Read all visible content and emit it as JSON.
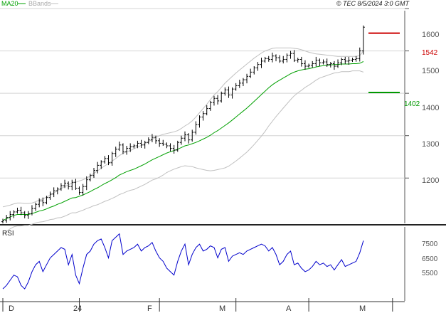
{
  "copyright": "© TEC 8/5/2024 3:0 GMT",
  "legend": {
    "ma_label": "MA20",
    "bbands_label": "BBands"
  },
  "colors": {
    "candle": "#000000",
    "ma": "#00a000",
    "bbands": "#c0c0c0",
    "rsi": "#0000cc",
    "resistance": "#cc0000",
    "support": "#009900",
    "grid": "#d4d4d4"
  },
  "chart_data": [
    {
      "type": "line",
      "title": "",
      "y_ticks": [
        "1200",
        "1300",
        "1400",
        "1500",
        "1600"
      ],
      "ylim": [
        1093,
        1595
      ],
      "month_labels": [
        {
          "label": "D",
          "index": 0
        },
        {
          "label": "24",
          "index": 21
        },
        {
          "label": "F",
          "index": 43
        },
        {
          "label": "M",
          "index": 64
        },
        {
          "label": "A",
          "index": 84
        },
        {
          "label": "M",
          "index": 107
        }
      ],
      "levels": [
        {
          "name": "resistance",
          "label": "1542",
          "value": 1542
        },
        {
          "name": "support",
          "label": "1402",
          "value": 1402
        }
      ],
      "series": [
        {
          "name": "close",
          "values": [
            1100,
            1107,
            1114,
            1120,
            1124,
            1118,
            1112,
            1116,
            1128,
            1138,
            1146,
            1142,
            1154,
            1162,
            1170,
            1174,
            1182,
            1188,
            1180,
            1190,
            1176,
            1166,
            1180,
            1196,
            1206,
            1218,
            1230,
            1238,
            1246,
            1236,
            1258,
            1268,
            1278,
            1262,
            1270,
            1274,
            1276,
            1282,
            1278,
            1284,
            1290,
            1296,
            1288,
            1282,
            1280,
            1276,
            1270,
            1266,
            1284,
            1294,
            1302,
            1290,
            1308,
            1326,
            1344,
            1352,
            1364,
            1378,
            1388,
            1382,
            1400,
            1408,
            1396,
            1410,
            1418,
            1424,
            1432,
            1440,
            1450,
            1460,
            1468,
            1476,
            1482,
            1480,
            1488,
            1484,
            1476,
            1480,
            1490,
            1494,
            1478,
            1480,
            1470,
            1464,
            1466,
            1470,
            1478,
            1472,
            1474,
            1468,
            1470,
            1464,
            1472,
            1480,
            1476,
            1478,
            1480,
            1482,
            1500,
            1556
          ]
        },
        {
          "name": "MA20",
          "values": [
            1100,
            1104,
            1108,
            1112,
            1114,
            1114,
            1114,
            1114,
            1116,
            1119,
            1122,
            1124,
            1127,
            1131,
            1134,
            1138,
            1141,
            1145,
            1149,
            1153,
            1154,
            1157,
            1160,
            1164,
            1168,
            1173,
            1177,
            1182,
            1187,
            1191,
            1196,
            1201,
            1207,
            1211,
            1215,
            1218,
            1221,
            1225,
            1229,
            1233,
            1238,
            1243,
            1247,
            1251,
            1255,
            1259,
            1262,
            1265,
            1268,
            1272,
            1276,
            1278,
            1281,
            1284,
            1288,
            1292,
            1296,
            1301,
            1307,
            1312,
            1318,
            1324,
            1330,
            1337,
            1344,
            1351,
            1358,
            1365,
            1373,
            1381,
            1389,
            1397,
            1405,
            1413,
            1420,
            1426,
            1431,
            1436,
            1441,
            1446,
            1450,
            1453,
            1455,
            1457,
            1458,
            1460,
            1462,
            1464,
            1465,
            1466,
            1467,
            1468,
            1468,
            1469,
            1469,
            1469,
            1470,
            1470,
            1471,
            1475
          ]
        },
        {
          "name": "BBands upper",
          "values": [
            1132,
            1134,
            1136,
            1139,
            1141,
            1141,
            1140,
            1140,
            1141,
            1144,
            1148,
            1151,
            1155,
            1160,
            1165,
            1170,
            1175,
            1180,
            1184,
            1188,
            1190,
            1193,
            1196,
            1200,
            1205,
            1211,
            1217,
            1223,
            1229,
            1234,
            1240,
            1246,
            1253,
            1258,
            1262,
            1265,
            1269,
            1273,
            1277,
            1281,
            1286,
            1291,
            1296,
            1300,
            1303,
            1305,
            1307,
            1309,
            1312,
            1317,
            1323,
            1328,
            1335,
            1344,
            1354,
            1364,
            1374,
            1385,
            1396,
            1404,
            1414,
            1424,
            1432,
            1440,
            1448,
            1455,
            1462,
            1469,
            1476,
            1483,
            1489,
            1495,
            1500,
            1503,
            1506,
            1507,
            1507,
            1507,
            1507,
            1507,
            1506,
            1505,
            1503,
            1500,
            1497,
            1495,
            1493,
            1492,
            1491,
            1490,
            1489,
            1488,
            1487,
            1487,
            1487,
            1487,
            1487,
            1487,
            1489,
            1500
          ]
        },
        {
          "name": "BBands lower",
          "values": [
            1068,
            1074,
            1080,
            1085,
            1087,
            1087,
            1088,
            1088,
            1091,
            1094,
            1096,
            1097,
            1099,
            1102,
            1103,
            1106,
            1107,
            1110,
            1114,
            1118,
            1118,
            1121,
            1124,
            1128,
            1131,
            1135,
            1137,
            1141,
            1145,
            1148,
            1152,
            1156,
            1161,
            1164,
            1168,
            1171,
            1173,
            1177,
            1181,
            1185,
            1190,
            1195,
            1198,
            1202,
            1207,
            1213,
            1217,
            1221,
            1224,
            1227,
            1229,
            1228,
            1227,
            1224,
            1222,
            1220,
            1218,
            1217,
            1218,
            1220,
            1222,
            1224,
            1228,
            1234,
            1240,
            1247,
            1254,
            1261,
            1270,
            1279,
            1289,
            1299,
            1310,
            1323,
            1334,
            1345,
            1355,
            1365,
            1375,
            1385,
            1394,
            1401,
            1407,
            1414,
            1419,
            1425,
            1431,
            1436,
            1439,
            1442,
            1445,
            1448,
            1449,
            1451,
            1451,
            1451,
            1453,
            1453,
            1453,
            1450
          ]
        },
        {
          "name": "RSI",
          "values": [
            50,
            52,
            55,
            58,
            57,
            52,
            50,
            54,
            60,
            64,
            66,
            60,
            64,
            68,
            70,
            72,
            74,
            73,
            64,
            70,
            58,
            53,
            62,
            70,
            72,
            76,
            78,
            79,
            74,
            68,
            78,
            80,
            82,
            70,
            72,
            73,
            74,
            76,
            72,
            74,
            75,
            77,
            72,
            68,
            66,
            62,
            60,
            58,
            66,
            72,
            76,
            64,
            70,
            74,
            76,
            72,
            73,
            75,
            74,
            68,
            73,
            74,
            66,
            69,
            70,
            71,
            70,
            72,
            73,
            74,
            75,
            76,
            75,
            72,
            74,
            70,
            64,
            66,
            70,
            72,
            64,
            65,
            62,
            60,
            61,
            63,
            66,
            64,
            65,
            63,
            64,
            61,
            64,
            67,
            63,
            64,
            65,
            66,
            71,
            78
          ]
        }
      ]
    },
    {
      "type": "line",
      "title": "RSI",
      "y_ticks": [
        "5500",
        "6500",
        "7500"
      ],
      "ylim": [
        43,
        86
      ]
    }
  ]
}
